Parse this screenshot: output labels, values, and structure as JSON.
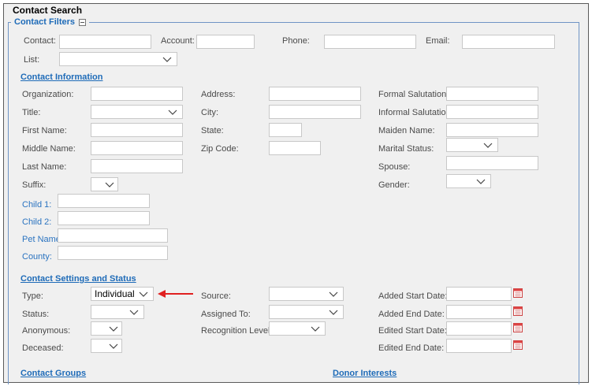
{
  "window": {
    "title": "Contact Search"
  },
  "filters": {
    "legend": "Contact Filters",
    "contact_label": "Contact:",
    "account_label": "Account:",
    "phone_label": "Phone:",
    "email_label": "Email:",
    "list_label": "List:",
    "contact_value": "",
    "account_value": "",
    "phone_value": "",
    "email_value": "",
    "list_value": ""
  },
  "contact_info": {
    "heading": "Contact Information",
    "organization_label": "Organization:",
    "title_label": "Title:",
    "first_name_label": "First Name:",
    "middle_name_label": "Middle Name:",
    "last_name_label": "Last Name:",
    "suffix_label": "Suffix:",
    "address_label": "Address:",
    "city_label": "City:",
    "state_label": "State:",
    "zip_label": "Zip Code:",
    "formal_salutation_label": "Formal Salutation:",
    "informal_salutation_label": "Informal Salutation:",
    "maiden_name_label": "Maiden Name:",
    "marital_status_label": "Marital Status:",
    "spouse_label": "Spouse:",
    "gender_label": "Gender:",
    "child1_label": "Child 1:",
    "child2_label": "Child 2:",
    "pet_name_label": "Pet Name:",
    "county_label": "County:"
  },
  "settings": {
    "heading": "Contact Settings and Status",
    "type_label": "Type:",
    "type_value": "Individual",
    "status_label": "Status:",
    "anonymous_label": "Anonymous:",
    "deceased_label": "Deceased:",
    "source_label": "Source:",
    "assigned_to_label": "Assigned To:",
    "recognition_level_label": "Recognition Level:",
    "added_start_label": "Added Start Date:",
    "added_end_label": "Added End Date:",
    "edited_start_label": "Edited Start Date:",
    "edited_end_label": "Edited End Date:"
  },
  "footer": {
    "groups_heading": "Contact Groups",
    "interests_heading": "Donor Interests"
  },
  "colors": {
    "accent": "#1e6bb8",
    "arrow": "#e02020",
    "background": "#f0f0f0"
  },
  "icons": {
    "dropdown": "chevron-down-icon",
    "calendar": "calendar-icon",
    "collapse": "collapse-minus-icon",
    "pointer": "red-arrow-icon"
  }
}
